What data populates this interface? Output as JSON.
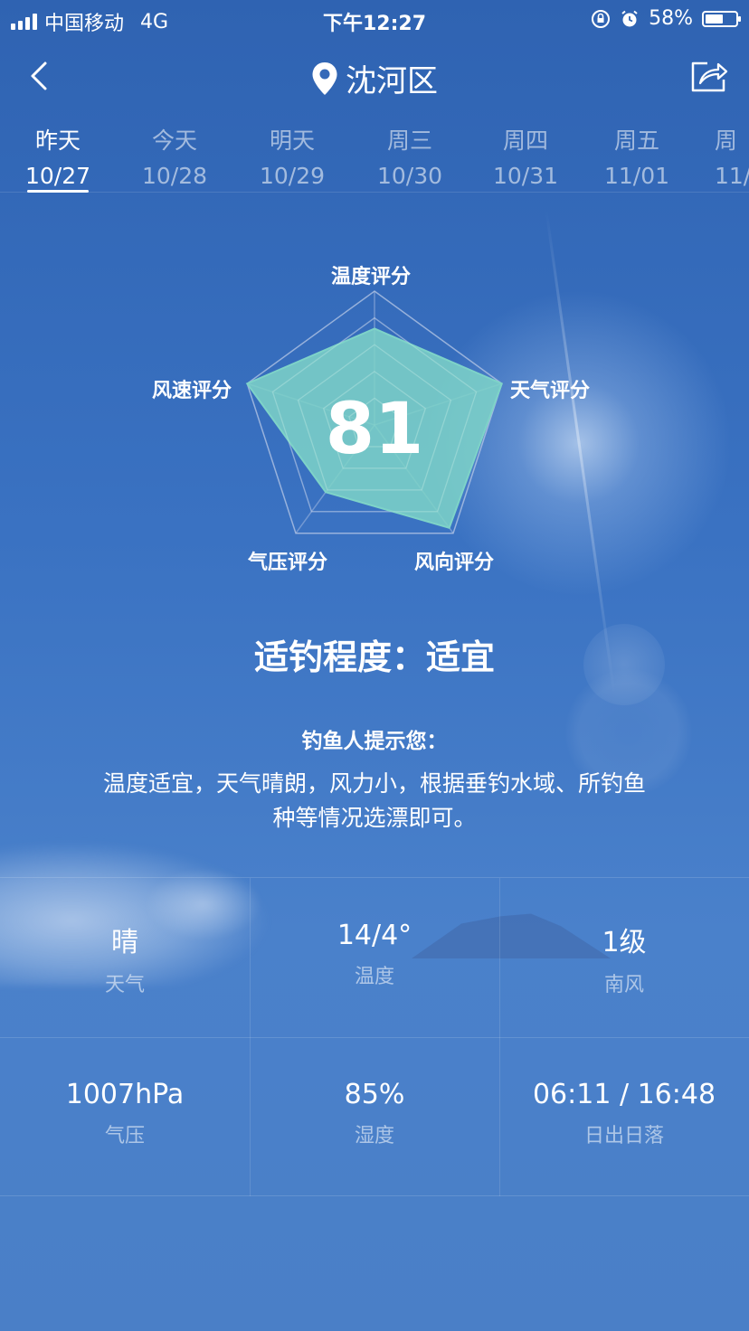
{
  "status_bar": {
    "carrier": "中国移动",
    "network": "4G",
    "time": "下午12:27",
    "battery": "58%",
    "battery_level": 0.58
  },
  "header": {
    "location": "沈河区"
  },
  "tabs": [
    {
      "day": "昨天",
      "date": "10/27",
      "active": true
    },
    {
      "day": "今天",
      "date": "10/28",
      "active": false
    },
    {
      "day": "明天",
      "date": "10/29",
      "active": false
    },
    {
      "day": "周三",
      "date": "10/30",
      "active": false
    },
    {
      "day": "周四",
      "date": "10/31",
      "active": false
    },
    {
      "day": "周五",
      "date": "11/01",
      "active": false
    },
    {
      "day": "周",
      "date": "11/",
      "active": false
    }
  ],
  "chart_data": {
    "type": "radar",
    "score": "81",
    "axes": [
      "温度评分",
      "天气评分",
      "风向评分",
      "气压评分",
      "风速评分"
    ],
    "values": [
      0.72,
      1.0,
      0.95,
      0.62,
      1.0
    ],
    "fill_color": "#7ed3c8",
    "grid_color": "#b8c8e6"
  },
  "suitability": {
    "text": "适钓程度：适宜"
  },
  "tips": {
    "title": "钓鱼人提示您：",
    "text": "温度适宜，天气晴朗，风力小，根据垂钓水域、所钓鱼种等情况选漂即可。"
  },
  "details": [
    {
      "value": "晴",
      "label": "天气"
    },
    {
      "value": "14/4°",
      "label": "温度"
    },
    {
      "value": "1级",
      "label": "南风"
    },
    {
      "value": "1007hPa",
      "label": "气压"
    },
    {
      "value": "85%",
      "label": "湿度"
    },
    {
      "value": "06:11 / 16:48",
      "label": "日出日落"
    }
  ]
}
